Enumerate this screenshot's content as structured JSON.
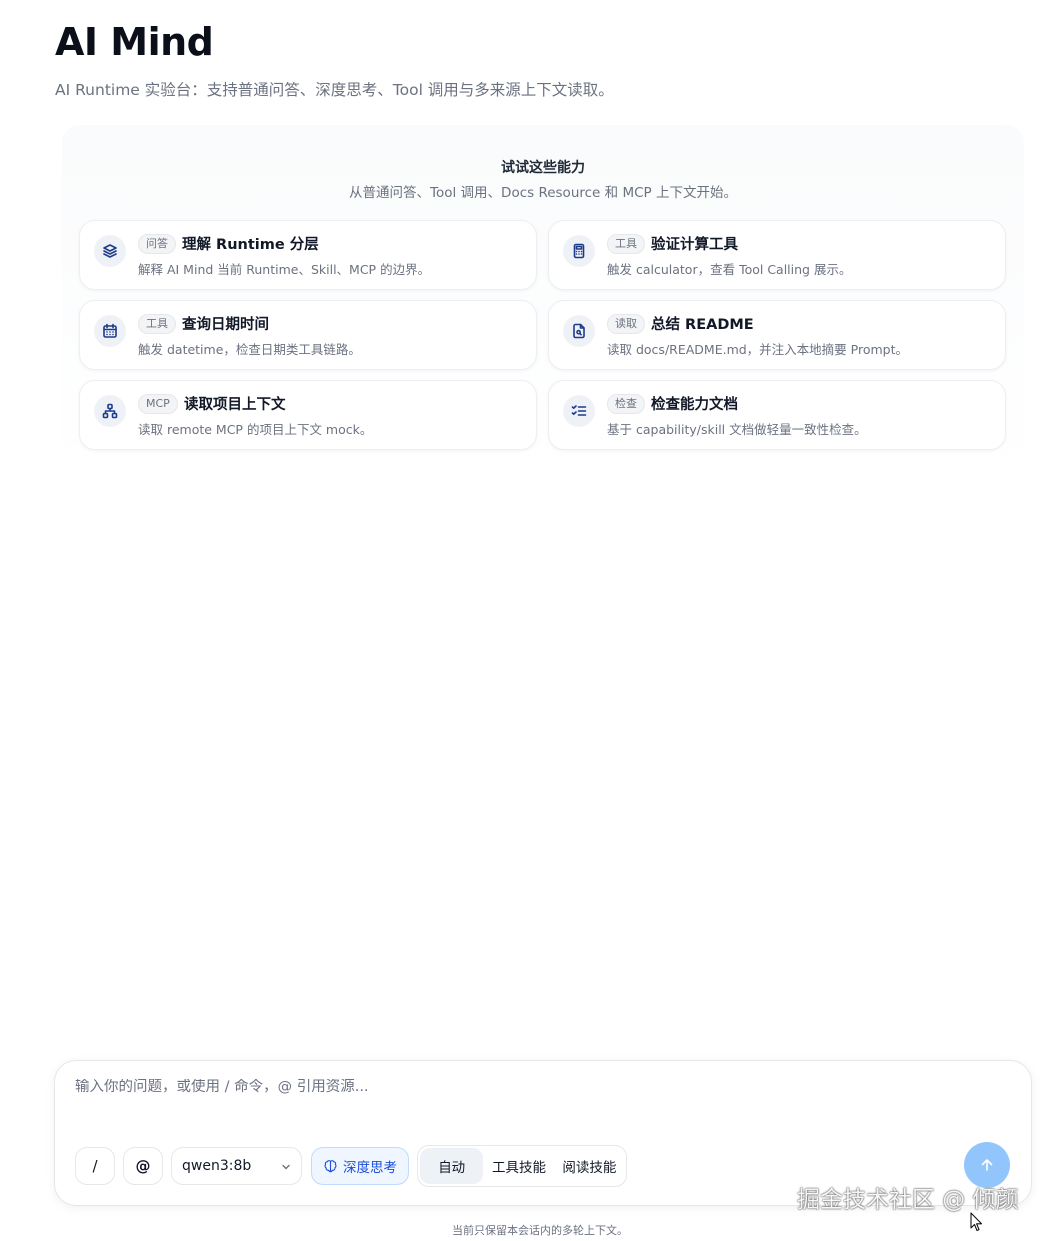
{
  "header": {
    "title": "AI Mind",
    "subtitle": "AI Runtime 实验台：支持普通问答、深度思考、Tool 调用与多来源上下文读取。"
  },
  "suggestions": {
    "title": "试试这些能力",
    "subtitle": "从普通问答、Tool 调用、Docs Resource 和 MCP 上下文开始。",
    "cards": [
      {
        "icon": "layers-icon",
        "tag": "问答",
        "title": "理解 Runtime 分层",
        "desc": "解释 AI Mind 当前 Runtime、Skill、MCP 的边界。"
      },
      {
        "icon": "calculator-icon",
        "tag": "工具",
        "title": "验证计算工具",
        "desc": "触发 calculator，查看 Tool Calling 展示。"
      },
      {
        "icon": "calendar-icon",
        "tag": "工具",
        "title": "查询日期时间",
        "desc": "触发 datetime，检查日期类工具链路。"
      },
      {
        "icon": "file-search-icon",
        "tag": "读取",
        "title": "总结 README",
        "desc": "读取 docs/README.md，并注入本地摘要 Prompt。"
      },
      {
        "icon": "network-icon",
        "tag": "MCP",
        "title": "读取项目上下文",
        "desc": "读取 remote MCP 的项目上下文 mock。"
      },
      {
        "icon": "checklist-icon",
        "tag": "检查",
        "title": "检查能力文档",
        "desc": "基于 capability/skill 文档做轻量一致性检查。"
      }
    ]
  },
  "composer": {
    "placeholder": "输入你的问题，或使用 / 命令，@ 引用资源...",
    "slash_label": "/",
    "at_label": "@",
    "model": "qwen3:8b",
    "deep_think_label": "深度思考",
    "modes": [
      "自动",
      "工具技能",
      "阅读技能"
    ],
    "active_mode": "自动",
    "send_color": "#93c5fd"
  },
  "footer": {
    "note": "当前只保留本会话内的多轮上下文。"
  },
  "watermark": "掘金技术社区 @ 倾颜"
}
